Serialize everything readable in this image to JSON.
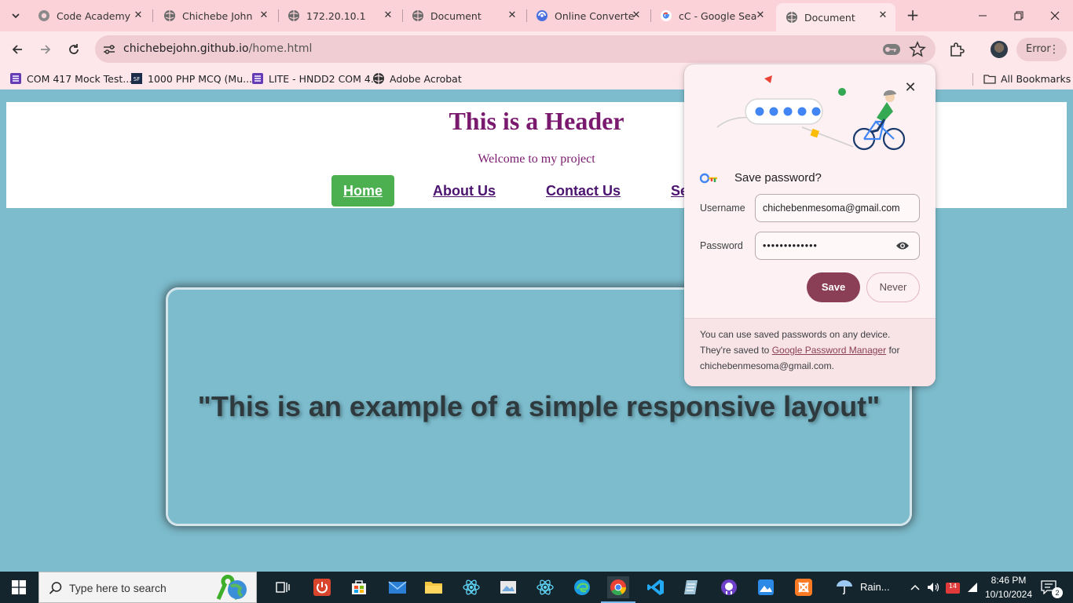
{
  "browser": {
    "tabs": [
      {
        "title": "Code Academy",
        "icon": "globe-icon",
        "active": false
      },
      {
        "title": "Chichebe John",
        "icon": "globe-icon",
        "active": false
      },
      {
        "title": "172.20.10.1",
        "icon": "globe-icon",
        "active": false
      },
      {
        "title": "Document",
        "icon": "globe-icon",
        "active": false
      },
      {
        "title": "Online Converte",
        "icon": "converter-icon",
        "active": false
      },
      {
        "title": "cC - Google Sea",
        "icon": "google-icon",
        "active": false
      },
      {
        "title": "Document",
        "icon": "globe-icon",
        "active": true
      }
    ],
    "url_host": "chichebejohn.github.io",
    "url_path": "/home.html",
    "profile_chip": "Error",
    "bookmarks": [
      {
        "label": "COM 417 Mock Test...",
        "icon": "list-icon"
      },
      {
        "label": "1000 PHP MCQ (Mu...",
        "icon": "sf-icon"
      },
      {
        "label": "LITE - HNDD2 COM 4...",
        "icon": "list-icon"
      },
      {
        "label": "Adobe Acrobat",
        "icon": "globe-icon"
      }
    ],
    "all_bookmarks_label": "All Bookmarks",
    "accent": "#fcd2d9"
  },
  "site": {
    "title": "This is a Header",
    "subtitle": "Welcome to my project",
    "nav": [
      {
        "label": "Home",
        "active": true
      },
      {
        "label": "About Us",
        "active": false
      },
      {
        "label": "Contact Us",
        "active": false
      },
      {
        "label": "Se",
        "active": false
      }
    ],
    "hero_text": "\"This is an example of a simple responsive layout\"",
    "background": "#7cbccd",
    "nav_active_color": "#4caf50",
    "title_color": "#7a1a6e"
  },
  "password_popup": {
    "title": "Save password?",
    "username_label": "Username",
    "username_value": "chichebenmesoma@gmail.com",
    "password_label": "Password",
    "password_value": "•••••••••••••",
    "save_label": "Save",
    "never_label": "Never",
    "footer_text_1": "You can use saved passwords on any device. They're saved to",
    "footer_link": "Google Password Manager",
    "footer_text_2": "for",
    "footer_account": "chichebenmesoma@gmail.com.",
    "save_color": "#8b3f56"
  },
  "taskbar": {
    "search_placeholder": "Type here to search",
    "weather_text": "Rain...",
    "time": "8:46 PM",
    "date": "10/10/2024",
    "calendar_badge": "14",
    "notification_count": "2"
  }
}
